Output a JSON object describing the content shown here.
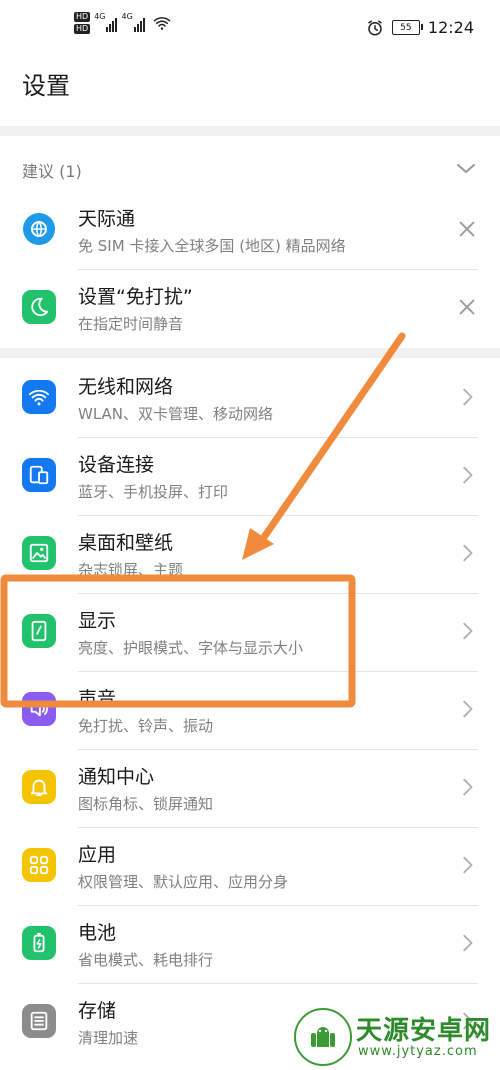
{
  "status_bar": {
    "hd1": "HD",
    "hd2": "HD",
    "sig1_label": "4G",
    "sig2_label": "4G",
    "battery": "55",
    "time": "12:24"
  },
  "page": {
    "title": "设置"
  },
  "suggestions": {
    "label": "建议 (1)",
    "items": [
      {
        "title": "天际通",
        "subtitle": "免 SIM 卡接入全球多国 (地区) 精品网络",
        "icon": "globe-icon",
        "color": "#1e9be8"
      },
      {
        "title": "设置“免打扰”",
        "subtitle": "在指定时间静音",
        "icon": "moon-icon",
        "color": "#21c26b"
      }
    ]
  },
  "settings": {
    "items": [
      {
        "title": "无线和网络",
        "subtitle": "WLAN、双卡管理、移动网络",
        "icon": "wifi-icon",
        "color": "#1478f0"
      },
      {
        "title": "设备连接",
        "subtitle": "蓝牙、手机投屏、打印",
        "icon": "device-connect-icon",
        "color": "#1478f0"
      },
      {
        "title": "桌面和壁纸",
        "subtitle": "杂志锁屏、主题",
        "icon": "wallpaper-icon",
        "color": "#21c26b"
      },
      {
        "title": "显示",
        "subtitle": "亮度、护眼模式、字体与显示大小",
        "icon": "display-icon",
        "color": "#21c26b"
      },
      {
        "title": "声音",
        "subtitle": "免打扰、铃声、振动",
        "icon": "speaker-icon",
        "color": "#8a5cf0"
      },
      {
        "title": "通知中心",
        "subtitle": "图标角标、锁屏通知",
        "icon": "bell-icon",
        "color": "#f5c400"
      },
      {
        "title": "应用",
        "subtitle": "权限管理、默认应用、应用分身",
        "icon": "apps-icon",
        "color": "#f5c400"
      },
      {
        "title": "电池",
        "subtitle": "省电模式、耗电排行",
        "icon": "battery-icon",
        "color": "#21c26b"
      },
      {
        "title": "存储",
        "subtitle": "清理加速",
        "icon": "storage-icon",
        "color": "#8c8c8c"
      }
    ]
  },
  "watermark": {
    "name": "天源安卓网",
    "url": "www.jytyaz.com"
  },
  "annotation": {
    "color": "#f08a3c"
  }
}
